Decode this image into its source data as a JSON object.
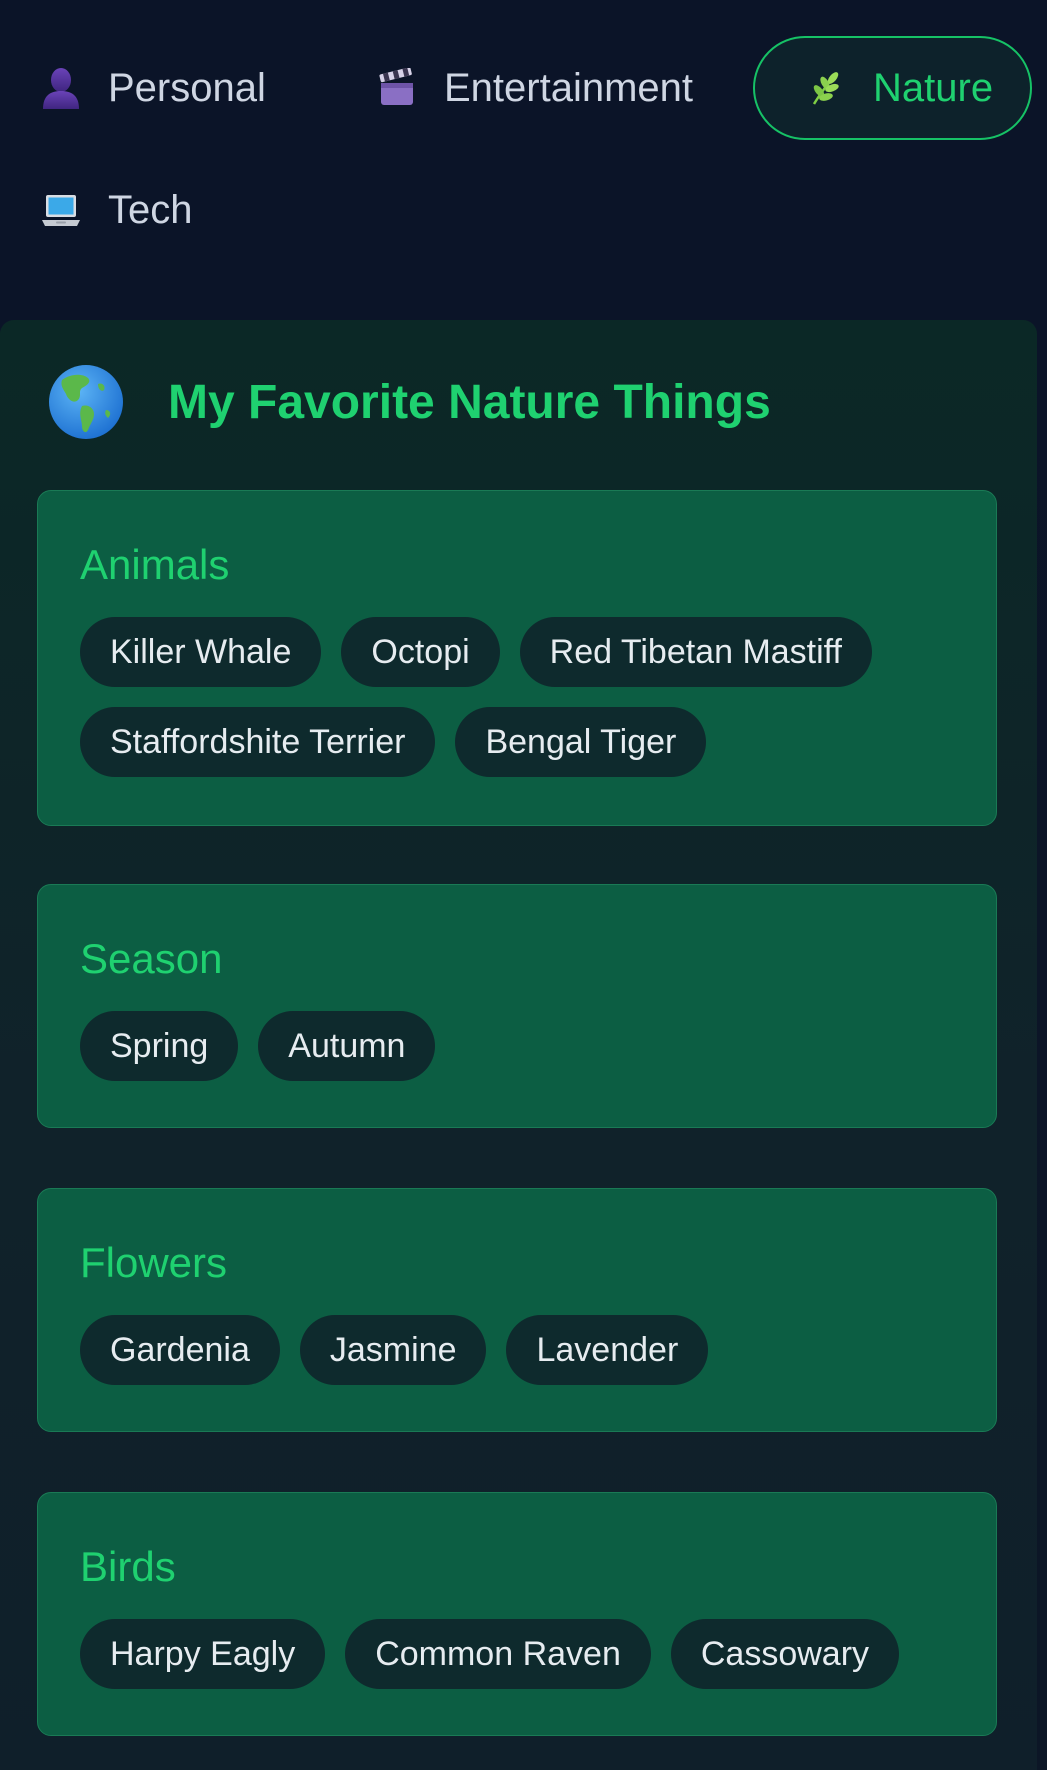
{
  "tabs": [
    {
      "label": "Personal",
      "icon": "person-silhouette-icon",
      "active": false
    },
    {
      "label": "Entertainment",
      "icon": "clapper-board-icon",
      "active": false
    },
    {
      "label": "Nature",
      "icon": "herb-icon",
      "active": true
    },
    {
      "label": "Tech",
      "icon": "laptop-icon",
      "active": false
    }
  ],
  "panel": {
    "title": "My Favorite Nature Things",
    "icon": "globe-americas-icon",
    "accent_color": "#1fd170"
  },
  "sections": [
    {
      "title": "Animals",
      "items": [
        "Killer Whale",
        "Octopi",
        "Red Tibetan Mastiff",
        "Staffordshite Terrier",
        "Bengal Tiger"
      ]
    },
    {
      "title": "Season",
      "items": [
        "Spring",
        "Autumn"
      ]
    },
    {
      "title": "Flowers",
      "items": [
        "Gardenia",
        "Jasmine",
        "Lavender"
      ]
    },
    {
      "title": "Birds",
      "items": [
        "Harpy Eagly",
        "Common Raven",
        "Cassowary"
      ]
    }
  ],
  "colors": {
    "background": "#0b1428",
    "card": "#0c5e43",
    "chip": "#0e2a2d",
    "accent": "#1fd170",
    "tab_text": "#cfd6e3"
  }
}
